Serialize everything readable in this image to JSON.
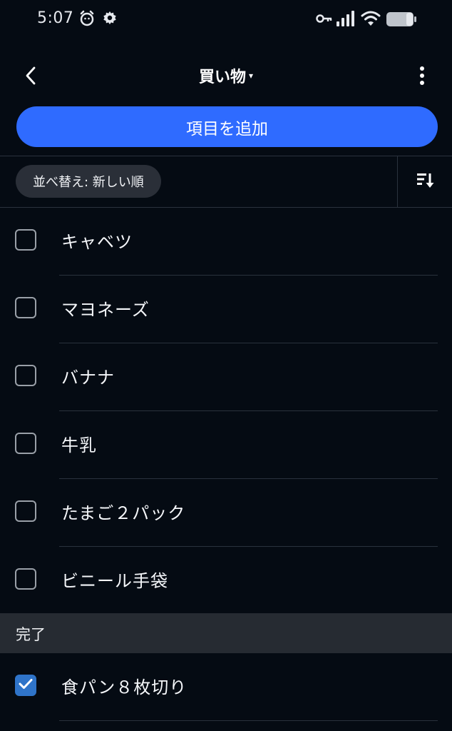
{
  "status_bar": {
    "time": "5:07",
    "icons": [
      "alarm-icon",
      "gear-icon",
      "key-icon",
      "signal-icon",
      "wifi-icon",
      "battery-icon"
    ]
  },
  "app_bar": {
    "title": "買い物",
    "caret": "▾",
    "back_icon": "back-arrow-icon",
    "menu_icon": "more-vert-icon"
  },
  "add_button": {
    "label": "項目を追加",
    "color": "#2f6bff"
  },
  "sort": {
    "chip_label": "並べ替え: 新しい順",
    "direction_icon": "sort-descending-icon"
  },
  "items": [
    {
      "label": "キャベツ",
      "checked": false
    },
    {
      "label": "マヨネーズ",
      "checked": false
    },
    {
      "label": "バナナ",
      "checked": false
    },
    {
      "label": "牛乳",
      "checked": false
    },
    {
      "label": "たまご２パック",
      "checked": false
    },
    {
      "label": "ビニール手袋",
      "checked": false
    }
  ],
  "done_section": {
    "header": "完了",
    "items": [
      {
        "label": "食パン８枚切り",
        "checked": true
      }
    ]
  },
  "colors": {
    "background": "#050b13",
    "accent": "#2f6bff",
    "checked": "#2f74c9",
    "section_header_bg": "#262b32"
  }
}
